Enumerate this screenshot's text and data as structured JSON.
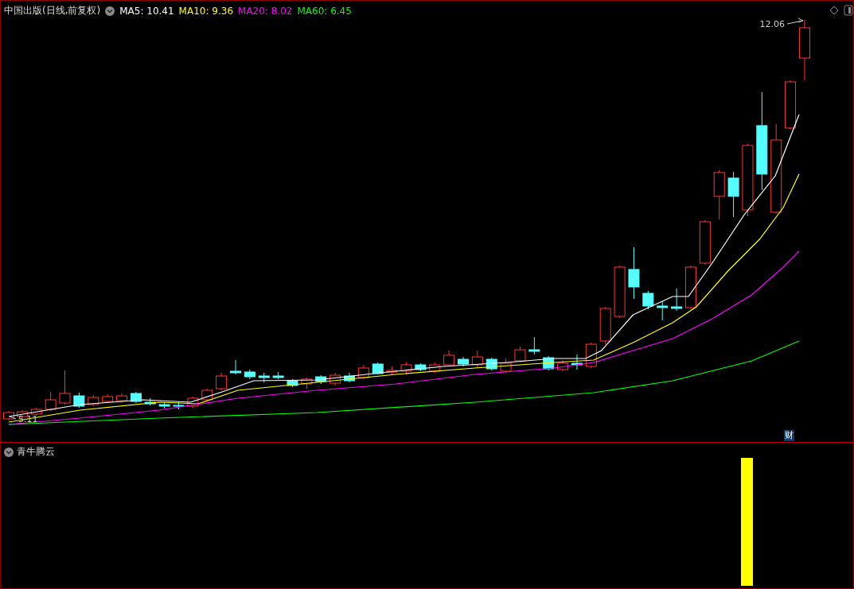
{
  "main_panel": {
    "title": "中国出版(日线,前复权)",
    "ma_legend": [
      {
        "label": "MA5:",
        "value": "10.41",
        "color": "#ffffff"
      },
      {
        "label": "MA10:",
        "value": "9.36",
        "color": "#ffff00"
      },
      {
        "label": "MA20:",
        "value": "8.02",
        "color": "#ff00ff"
      },
      {
        "label": "MA60:",
        "value": "6.45",
        "color": "#00ff00"
      }
    ],
    "high_label": "12.06",
    "low_label": "5.11",
    "badge": "财"
  },
  "indicator_panel": {
    "title": "青牛腾云"
  }
}
